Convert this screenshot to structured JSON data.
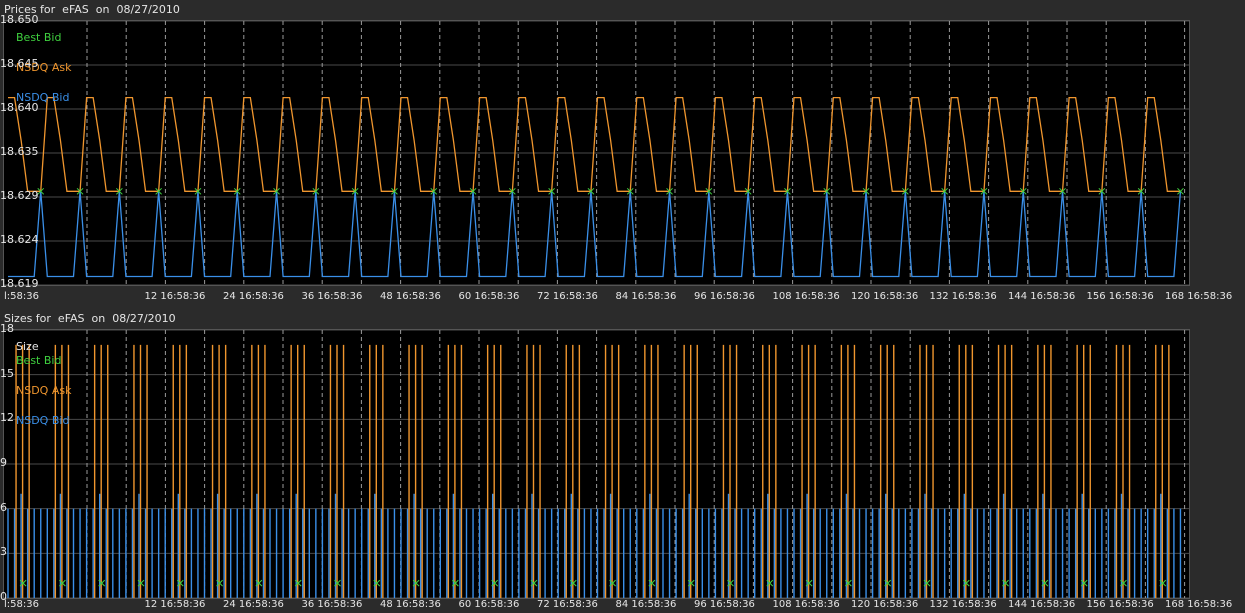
{
  "colors": {
    "best_bid": "#3fd13f",
    "nsdq_ask": "#f0962e",
    "nsdq_bid": "#3a8fe8",
    "grid": "#4a4a4a",
    "vgrid": "#9a9a9a"
  },
  "price_panel": {
    "title": "Prices for  eFAS  on  08/27/2010"
  },
  "size_panel": {
    "title": "Sizes for  eFAS  on  08/27/2010",
    "legend_header": "Size"
  },
  "chart_data": [
    {
      "type": "line",
      "title": "Prices for  eFAS  on  08/27/2010",
      "y_ticks": [
        "18.650",
        "18.645",
        "18.640",
        "18.635",
        "18.629",
        "18.624",
        "18.619"
      ],
      "ylim": [
        18.619,
        18.65
      ],
      "x_tick_labels": [
        "l:58:36",
        "12 16:58:36",
        "24 16:58:36",
        "36 16:58:36",
        "48 16:58:36",
        "60 16:58:36",
        "72 16:58:36",
        "84 16:58:36",
        "96 16:58:36",
        "108 16:58:36",
        "120 16:58:36",
        "132 16:58:36",
        "144 16:58:36",
        "156 16:58:36",
        "168 16:58:36"
      ],
      "grid": true,
      "legend_position": "top-left",
      "cycle_length": 6,
      "cycles": 30,
      "series": [
        {
          "name": "Best Bid",
          "marker": "x",
          "values_per_cycle": [
            18.63
          ],
          "marker_at_step": [
            5
          ]
        },
        {
          "name": "NSDQ Ask",
          "values_per_cycle": [
            18.641,
            18.641,
            18.636,
            18.63,
            18.63,
            18.63
          ]
        },
        {
          "name": "NSDQ Bid",
          "values_per_cycle": [
            18.62,
            18.62,
            18.62,
            18.62,
            18.62,
            18.63
          ]
        }
      ]
    },
    {
      "type": "bar",
      "title": "Sizes for  eFAS  on  08/27/2010",
      "y_ticks": [
        "18",
        "15",
        "12",
        "9",
        "6",
        "3",
        "0"
      ],
      "ylim": [
        0,
        18
      ],
      "x_tick_labels": [
        "l:58:36",
        "12 16:58:36",
        "24 16:58:36",
        "36 16:58:36",
        "48 16:58:36",
        "60 16:58:36",
        "72 16:58:36",
        "84 16:58:36",
        "96 16:58:36",
        "108 16:58:36",
        "120 16:58:36",
        "132 16:58:36",
        "144 16:58:36",
        "156 16:58:36",
        "168 16:58:36"
      ],
      "grid": true,
      "legend_position": "top-left",
      "series": [
        {
          "name": "Best Bid",
          "marker": "x",
          "value": 1
        },
        {
          "name": "NSDQ Ask",
          "value": 17,
          "steps_per_cycle": [
            1,
            2,
            3
          ]
        },
        {
          "name": "NSDQ Bid",
          "values_per_step": [
            6,
            6,
            7,
            6,
            6,
            6
          ]
        }
      ]
    }
  ]
}
